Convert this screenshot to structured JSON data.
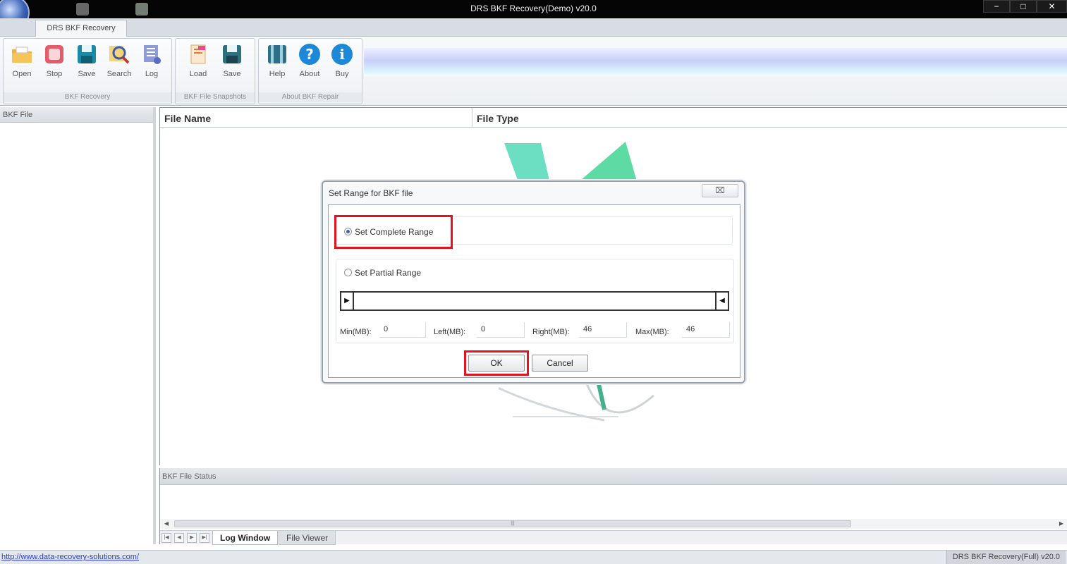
{
  "window": {
    "title": "DRS BKF Recovery(Demo) v20.0",
    "controls": [
      "−",
      "□",
      "✕"
    ]
  },
  "ribbon": {
    "tab": "DRS BKF Recovery",
    "groups": [
      {
        "label": "BKF Recovery",
        "buttons": [
          "Open",
          "Stop",
          "Save",
          "Search",
          "Log"
        ]
      },
      {
        "label": "BKF File Snapshots",
        "buttons": [
          "Load",
          "Save"
        ]
      },
      {
        "label": "About BKF Repair",
        "buttons": [
          "Help",
          "About",
          "Buy"
        ]
      }
    ]
  },
  "left_panel": {
    "header": "BKF File"
  },
  "file_list": {
    "columns": [
      "File Name",
      "File Type"
    ]
  },
  "status_panel": {
    "header": "BKF File Status",
    "tabs": [
      "Log Window",
      "File Viewer"
    ],
    "scroll_grip": "|||"
  },
  "status_bar": {
    "link": "http://www.data-recovery-solutions.com/",
    "right": "DRS BKF Recovery(Full) v20.0"
  },
  "dialog": {
    "title": "Set Range for BKF file",
    "close_glyph": "⌧",
    "complete_range_label": "Set Complete Range",
    "partial_range_label": "Set Partial Range",
    "selected": "complete",
    "fields": [
      {
        "label": "Min(MB):",
        "value": "0"
      },
      {
        "label": "Left(MB):",
        "value": "0"
      },
      {
        "label": "Right(MB):",
        "value": "46"
      },
      {
        "label": "Max(MB):",
        "value": "46"
      }
    ],
    "ok_label": "OK",
    "cancel_label": "Cancel"
  },
  "colors": {
    "highlight": "#e0141e",
    "link": "#2a3bd0"
  }
}
